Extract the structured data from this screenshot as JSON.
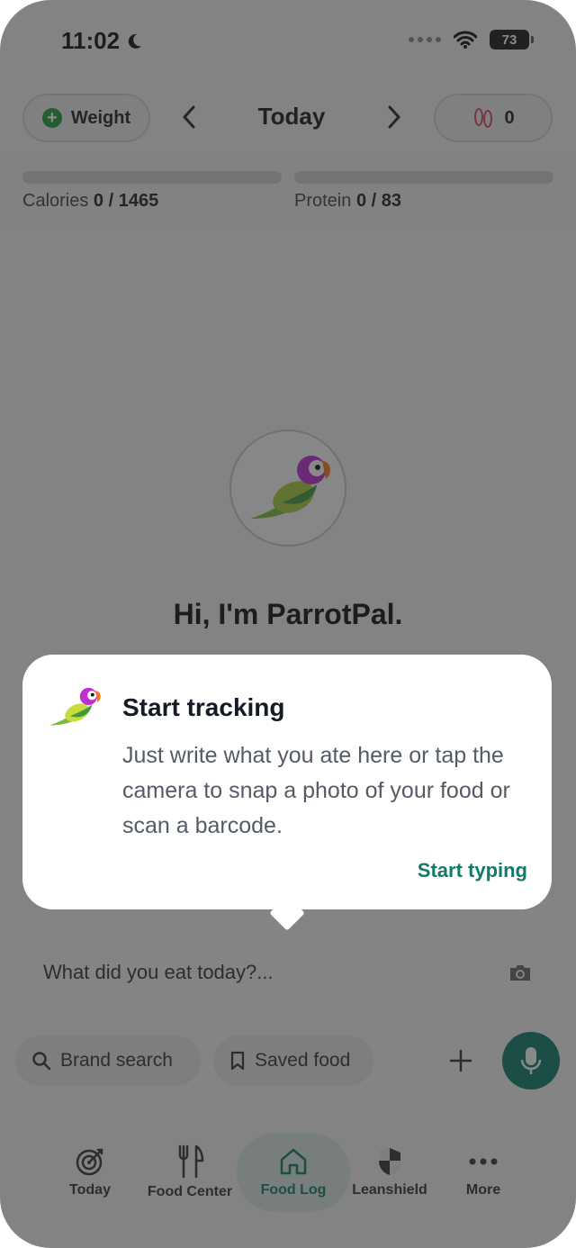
{
  "status_bar": {
    "time": "11:02",
    "battery": "73"
  },
  "header": {
    "weight_label": "Weight",
    "date_title": "Today",
    "steps_value": "0"
  },
  "progress": {
    "calories_label": "Calories",
    "calories_value": "0 / 1465",
    "protein_label": "Protein",
    "protein_value": "0 / 83"
  },
  "main": {
    "greeting": "Hi, I'm ParrotPal."
  },
  "tooltip": {
    "title": "Start tracking",
    "body": "Just write what you ate here or tap the camera to snap a photo of your food or scan a barcode.",
    "action": "Start typing"
  },
  "composer": {
    "placeholder": "What did you eat today?...",
    "chips": {
      "brand_search": "Brand search",
      "saved_food": "Saved food"
    }
  },
  "tabs": {
    "today": "Today",
    "food_center": "Food Center",
    "food_log": "Food Log",
    "leanshield": "Leanshield",
    "more": "More"
  },
  "colors": {
    "accent": "#0f7a6a",
    "add_green": "#1f9d3e",
    "scrim": "rgba(40,40,40,0.55)"
  },
  "icons": [
    "moon-icon",
    "wifi-icon",
    "battery-icon",
    "plus-circle-icon",
    "chevron-left-icon",
    "chevron-right-icon",
    "footprints-icon",
    "parrot-logo-icon",
    "camera-icon",
    "search-icon",
    "bookmark-icon",
    "plus-icon",
    "microphone-icon",
    "target-icon",
    "fork-knife-icon",
    "house-icon",
    "shield-icon",
    "more-dots-icon"
  ]
}
